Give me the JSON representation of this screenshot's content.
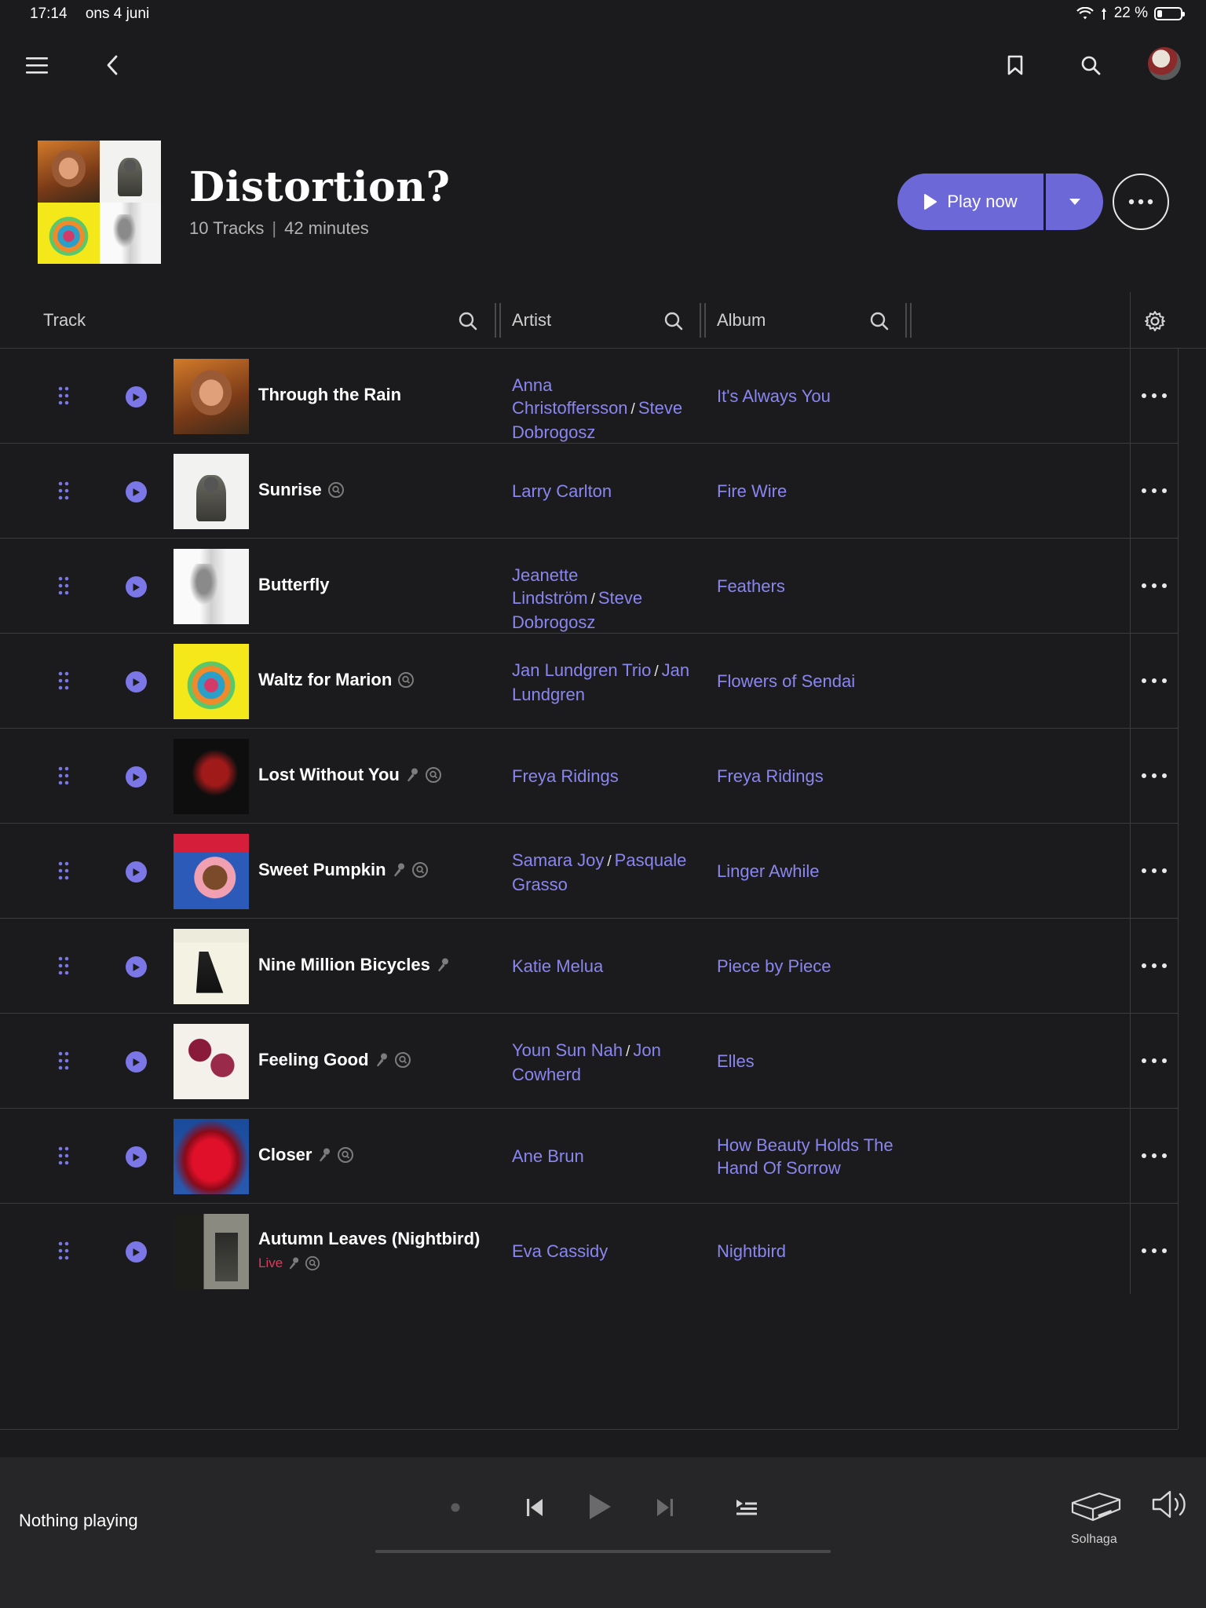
{
  "status_bar": {
    "time": "17:14",
    "date": "ons 4 juni",
    "battery": "22 %"
  },
  "playlist": {
    "title": "Distortion?",
    "tracks_count": "10 Tracks",
    "duration": "42 minutes"
  },
  "actions": {
    "play_label": "Play now"
  },
  "columns": {
    "track": "Track",
    "artist": "Artist",
    "album": "Album"
  },
  "tracks": [
    {
      "title": "Through the Rain",
      "artists": [
        "Anna Christoffersson",
        "Steve Dobrogosz"
      ],
      "album": "It's Always You",
      "flags": []
    },
    {
      "title": "Sunrise",
      "artists": [
        "Larry Carlton"
      ],
      "album": "Fire Wire",
      "flags": [
        "radio"
      ]
    },
    {
      "title": "Butterfly",
      "artists": [
        "Jeanette Lindström",
        "Steve Dobrogosz"
      ],
      "album": "Feathers",
      "flags": []
    },
    {
      "title": "Waltz for Marion",
      "artists": [
        "Jan Lundgren Trio",
        "Jan Lundgren"
      ],
      "album": "Flowers of Sendai",
      "flags": [
        "radio"
      ]
    },
    {
      "title": "Lost Without You",
      "artists": [
        "Freya Ridings"
      ],
      "album": "Freya Ridings",
      "flags": [
        "mic",
        "radio"
      ]
    },
    {
      "title": "Sweet Pumpkin",
      "artists": [
        "Samara Joy",
        "Pasquale Grasso"
      ],
      "album": "Linger Awhile",
      "flags": [
        "mic",
        "radio"
      ]
    },
    {
      "title": "Nine Million Bicycles",
      "artists": [
        "Katie Melua"
      ],
      "album": "Piece by Piece",
      "flags": [
        "mic"
      ]
    },
    {
      "title": "Feeling Good",
      "artists": [
        "Youn Sun Nah",
        "Jon Cowherd"
      ],
      "album": "Elles",
      "flags": [
        "mic",
        "radio"
      ]
    },
    {
      "title": "Closer",
      "artists": [
        "Ane Brun"
      ],
      "album": "How Beauty Holds The Hand Of Sorrow",
      "flags": [
        "mic",
        "radio"
      ]
    },
    {
      "title": "Autumn Leaves (Nightbird)",
      "artists": [
        "Eva Cassidy"
      ],
      "album": "Nightbird",
      "live_label": "Live",
      "flags": [
        "mic",
        "radio"
      ]
    }
  ],
  "player": {
    "status": "Nothing playing",
    "zone": "Solhaga"
  },
  "colors": {
    "accent": "#6c68d8",
    "link": "#8a86ef",
    "live": "#e23a5a",
    "background": "#1b1b1d",
    "player_bg": "#262628"
  }
}
